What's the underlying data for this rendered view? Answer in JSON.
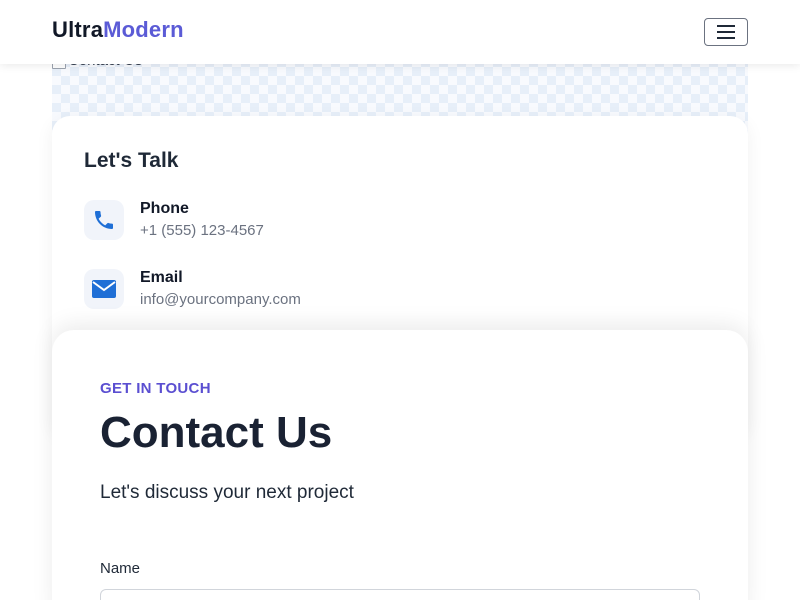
{
  "navbar": {
    "brand_part1": "Ultra",
    "brand_part2": "Modern",
    "menu_icon": "hamburger-menu-icon"
  },
  "hero": {
    "image_alt": "Contact Us"
  },
  "talk_card": {
    "title": "Let's Talk",
    "items": [
      {
        "icon": "phone-icon",
        "label": "Phone",
        "value": "+1 (555) 123-4567"
      },
      {
        "icon": "envelope-icon",
        "label": "Email",
        "value": "info@yourcompany.com"
      }
    ]
  },
  "form_card": {
    "eyebrow": "GET IN TOUCH",
    "title": "Contact Us",
    "subtitle": "Let's discuss your next project",
    "fields": [
      {
        "label": "Name",
        "value": "",
        "placeholder": ""
      }
    ]
  },
  "colors": {
    "accent": "#5b5bd6",
    "eyebrow": "#5b4fd1",
    "icon": "#1f6fd6"
  }
}
